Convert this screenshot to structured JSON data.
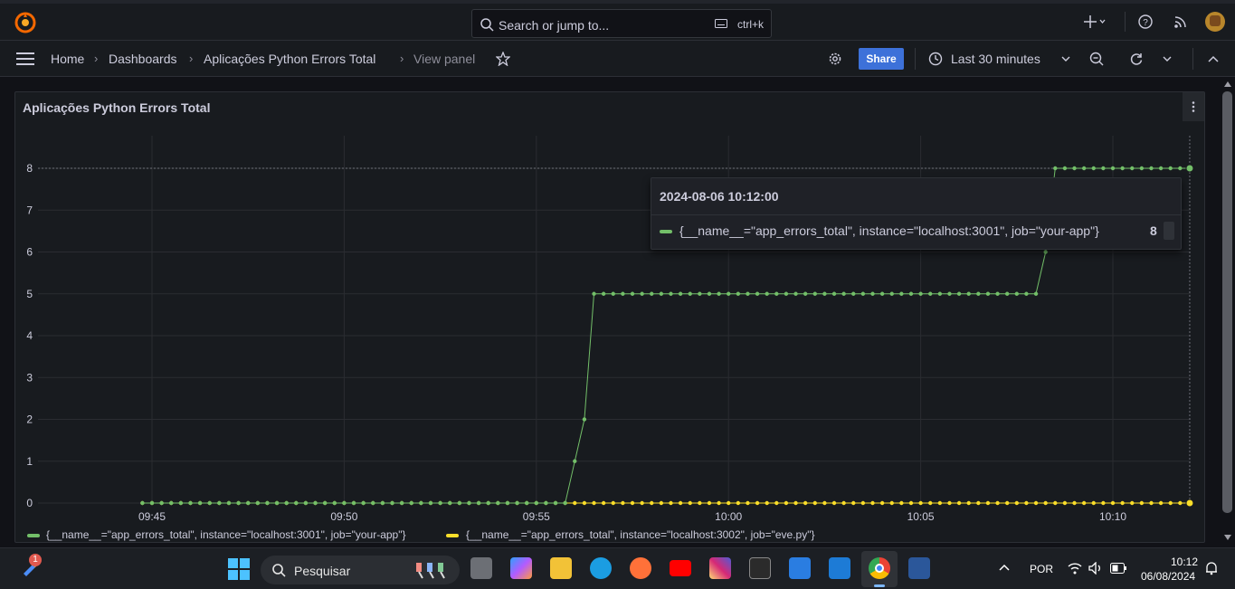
{
  "topbar": {
    "search_placeholder": "Search or jump to...",
    "search_shortcut": "ctrl+k"
  },
  "breadcrumb": {
    "home": "Home",
    "dashboards": "Dashboards",
    "dashboard": "Aplicações Python Errors Total",
    "current": "View panel"
  },
  "toolbar": {
    "share_label": "Share",
    "time_range": "Last 30 minutes"
  },
  "panel": {
    "title": "Aplicações Python Errors Total"
  },
  "tooltip": {
    "time": "2024-08-06 10:12:00",
    "series_label": "{__name__=\"app_errors_total\", instance=\"localhost:3001\", job=\"your-app\"}",
    "value": "8"
  },
  "legend": {
    "items": [
      {
        "label": "{__name__=\"app_errors_total\", instance=\"localhost:3001\", job=\"your-app\"}",
        "color": "#73bf69"
      },
      {
        "label": "{__name__=\"app_errors_total\", instance=\"localhost:3002\", job=\"eve.py\"}",
        "color": "#fade2a"
      }
    ]
  },
  "chart_data": {
    "type": "line",
    "ylim": [
      0,
      8
    ],
    "yticks": [
      "0",
      "1",
      "2",
      "3",
      "4",
      "5",
      "6",
      "7",
      "8"
    ],
    "xticks": [
      "09:45",
      "09:50",
      "09:55",
      "10:00",
      "10:05",
      "10:10"
    ],
    "grid": true,
    "series": [
      {
        "name": "{__name__=\"app_errors_total\", instance=\"localhost:3001\", job=\"your-app\"}",
        "color": "#73bf69",
        "x": [
          "09:44:45",
          "09:55:45",
          "09:56:00",
          "09:56:15",
          "09:56:30",
          "10:08:00",
          "10:08:15",
          "10:08:30",
          "10:12:00"
        ],
        "y": [
          0,
          0,
          1,
          2,
          5,
          5,
          6,
          8,
          8
        ]
      },
      {
        "name": "{__name__=\"app_errors_total\", instance=\"localhost:3002\", job=\"eve.py\"}",
        "color": "#fade2a",
        "x": [
          "09:44:45",
          "10:12:00"
        ],
        "y": [
          0,
          0
        ]
      }
    ]
  },
  "taskbar": {
    "search_placeholder": "Pesquisar",
    "badge": "1",
    "language": "POR",
    "time": "10:12",
    "date": "06/08/2024"
  }
}
